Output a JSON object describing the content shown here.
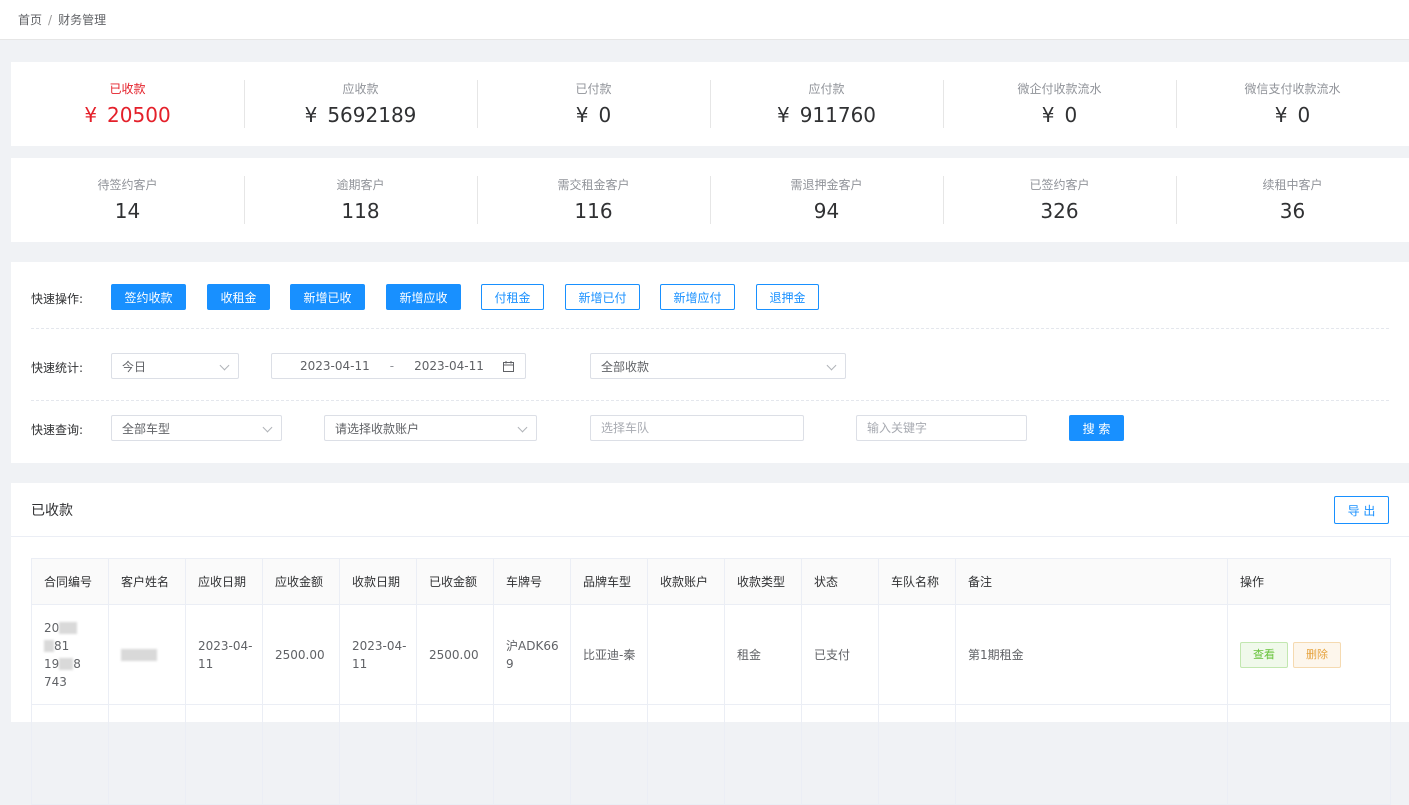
{
  "breadcrumb": {
    "home": "首页",
    "separator": "/",
    "current": "财务管理"
  },
  "money_stats": [
    {
      "label": "已收款",
      "currency": "¥",
      "value": "20500"
    },
    {
      "label": "应收款",
      "currency": "¥",
      "value": "5692189"
    },
    {
      "label": "已付款",
      "currency": "¥",
      "value": "0"
    },
    {
      "label": "应付款",
      "currency": "¥",
      "value": "911760"
    },
    {
      "label": "微企付收款流水",
      "currency": "¥",
      "value": "0"
    },
    {
      "label": "微信支付收款流水",
      "currency": "¥",
      "value": "0"
    }
  ],
  "customer_stats": [
    {
      "label": "待签约客户",
      "value": "14"
    },
    {
      "label": "逾期客户",
      "value": "118"
    },
    {
      "label": "需交租金客户",
      "value": "116"
    },
    {
      "label": "需退押金客户",
      "value": "94"
    },
    {
      "label": "已签约客户",
      "value": "326"
    },
    {
      "label": "续租中客户",
      "value": "36"
    }
  ],
  "quick_ops": {
    "label": "快速操作:",
    "buttons": [
      "签约收款",
      "收租金",
      "新增已收",
      "新增应收",
      "付租金",
      "新增已付",
      "新增应付",
      "退押金"
    ]
  },
  "quick_stats": {
    "label": "快速统计:",
    "period": "今日",
    "date_start": "2023-04-11",
    "date_sep": "-",
    "date_end": "2023-04-11",
    "collection_type": "全部收款"
  },
  "quick_query": {
    "label": "快速查询:",
    "car_type": "全部车型",
    "account_placeholder": "请选择收款账户",
    "fleet_placeholder": "选择车队",
    "keyword_placeholder": "输入关键字",
    "search_label": "搜 索"
  },
  "list": {
    "title": "已收款",
    "export_label": "导 出",
    "columns": [
      "合同编号",
      "客户姓名",
      "应收日期",
      "应收金额",
      "收款日期",
      "已收金额",
      "车牌号",
      "品牌车型",
      "收款账户",
      "收款类型",
      "状态",
      "车队名称",
      "备注",
      "操作"
    ],
    "rows": [
      {
        "contract": [
          "20",
          "1",
          "81",
          "19",
          "8",
          "743"
        ],
        "receivable_date": "2023-04-11",
        "receivable_amount": "2500.00",
        "received_date": "2023-04-11",
        "received_amount": "2500.00",
        "plate": "沪ADK669",
        "model": "比亚迪-秦",
        "account": "",
        "type": "租金",
        "status": "已支付",
        "fleet": "",
        "remark": "第1期租金",
        "view_label": "查看",
        "delete_label": "删除"
      }
    ]
  }
}
